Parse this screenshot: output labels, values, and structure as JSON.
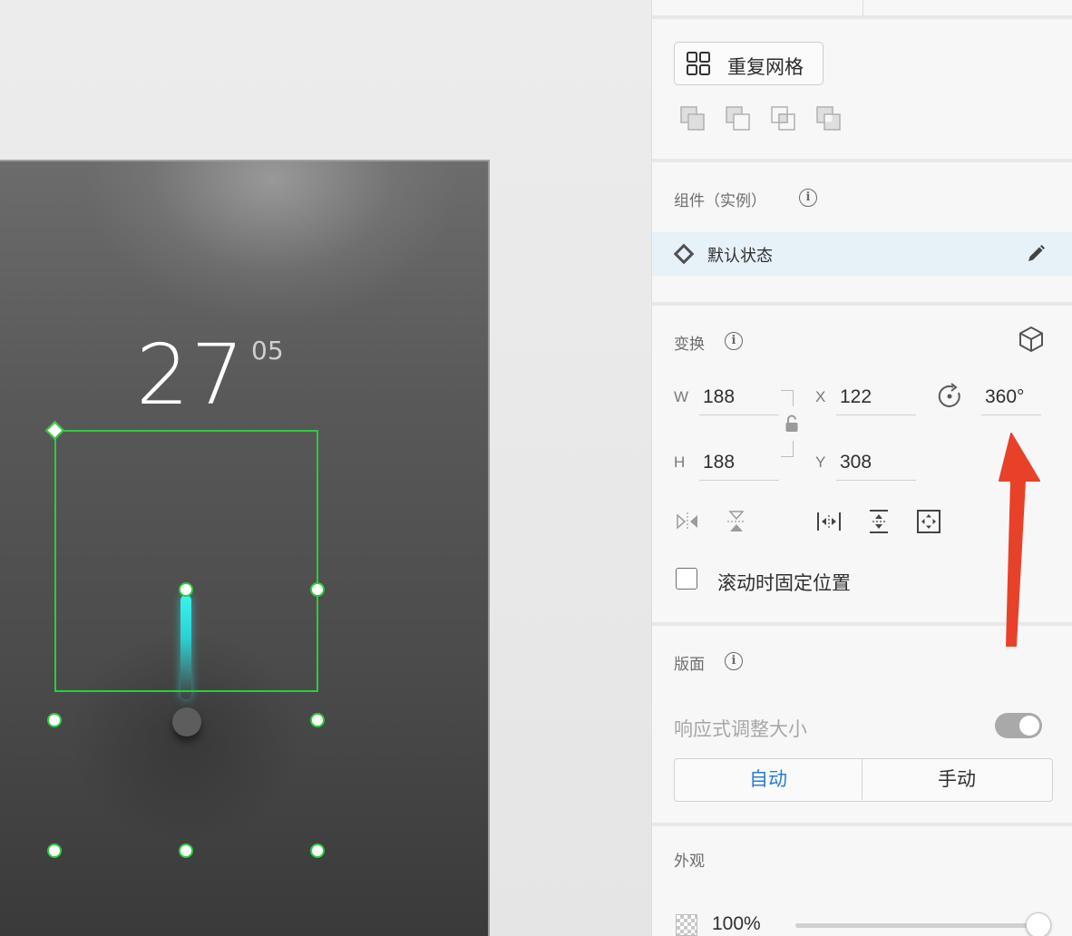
{
  "canvas": {
    "temperature": "27",
    "temperature_decimal": "05"
  },
  "toolbar": {
    "repeat_grid_label": "重复网格"
  },
  "component": {
    "section_title": "组件（实例）",
    "state_label": "默认状态"
  },
  "transform": {
    "section_title": "变换",
    "w_label": "W",
    "w_value": "188",
    "h_label": "H",
    "h_value": "188",
    "x_label": "X",
    "x_value": "122",
    "y_label": "Y",
    "y_value": "308",
    "rotation_value": "360°",
    "fix_position_label": "滚动时固定位置"
  },
  "layout": {
    "section_title": "版面",
    "responsive_label": "响应式调整大小",
    "segment_auto": "自动",
    "segment_manual": "手动"
  },
  "appearance": {
    "section_title": "外观",
    "opacity_value": "100%"
  },
  "colors": {
    "selection": "#2bcc3f",
    "indicator": "#39f3ee",
    "accent_blue": "#2b7cd3",
    "annotation_arrow": "#e8412a"
  }
}
